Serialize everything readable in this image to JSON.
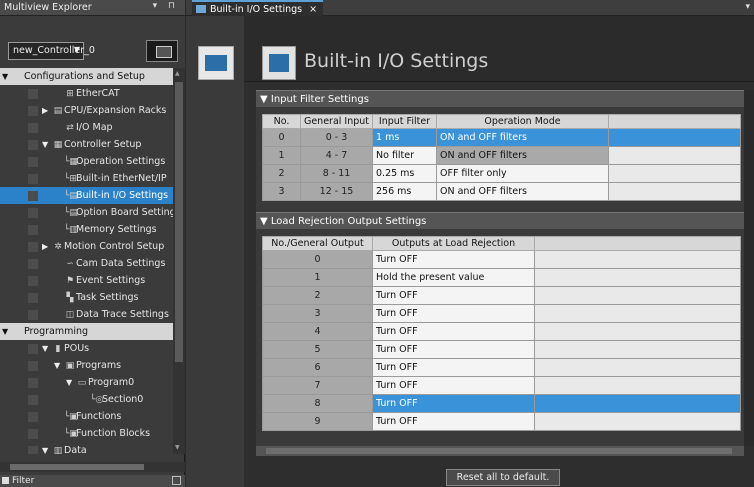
{
  "explorer": {
    "title": "Multiview Explorer",
    "title_controls": "▾ ⊓",
    "controller": "new_Controller_0",
    "tree": [
      {
        "label": "Configurations and Setup",
        "level": 0,
        "type": "header",
        "exp": "▼",
        "icon": ""
      },
      {
        "label": "EtherCAT",
        "level": 2,
        "exp": "",
        "icon": "⊞"
      },
      {
        "label": "CPU/Expansion Racks",
        "level": 1,
        "exp": "▶",
        "icon": "▤"
      },
      {
        "label": "I/O Map",
        "level": 2,
        "exp": "",
        "icon": "⇄"
      },
      {
        "label": "Controller Setup",
        "level": 1,
        "exp": "▼",
        "icon": "▦"
      },
      {
        "label": "Operation Settings",
        "level": 2,
        "exp": "",
        "icon": "└▦"
      },
      {
        "label": "Built-in EtherNet/IP",
        "level": 2,
        "exp": "",
        "icon": "└⊞"
      },
      {
        "label": "Built-in I/O Settings",
        "level": 2,
        "exp": "",
        "icon": "└▤",
        "selected": true
      },
      {
        "label": "Option Board Settings",
        "level": 2,
        "exp": "",
        "icon": "└▤"
      },
      {
        "label": "Memory Settings",
        "level": 2,
        "exp": "",
        "icon": "└▥"
      },
      {
        "label": "Motion Control Setup",
        "level": 1,
        "exp": "▶",
        "icon": "✲"
      },
      {
        "label": "Cam Data Settings",
        "level": 2,
        "exp": "",
        "icon": "∽"
      },
      {
        "label": "Event Settings",
        "level": 2,
        "exp": "",
        "icon": "⚑"
      },
      {
        "label": "Task Settings",
        "level": 2,
        "exp": "",
        "icon": "▚"
      },
      {
        "label": "Data Trace Settings",
        "level": 2,
        "exp": "",
        "icon": "◫"
      },
      {
        "label": "Programming",
        "level": 0,
        "type": "header",
        "exp": "▼",
        "icon": ""
      },
      {
        "label": "POUs",
        "level": 1,
        "exp": "▼",
        "icon": "▮"
      },
      {
        "label": "Programs",
        "level": 2,
        "exp": "▼",
        "icon": "▣"
      },
      {
        "label": "Program0",
        "level": 3,
        "exp": "▼",
        "icon": "▭"
      },
      {
        "label": "Section0",
        "level": 4,
        "exp": "",
        "icon": "└◎"
      },
      {
        "label": "Functions",
        "level": 2,
        "exp": "",
        "icon": "└▣"
      },
      {
        "label": "Function Blocks",
        "level": 2,
        "exp": "",
        "icon": "└▣"
      },
      {
        "label": "Data",
        "level": 1,
        "exp": "▼",
        "icon": "▥"
      }
    ],
    "filter_label": "Filter"
  },
  "tab": {
    "label": "Built-in I/O Settings",
    "close": "×",
    "menu": "▾"
  },
  "page_title": "Built-in I/O Settings",
  "input_filter": {
    "section_label": "▼ Input Filter Settings",
    "headers": [
      "No.",
      "General Input",
      "Input Filter",
      "Operation Mode",
      ""
    ],
    "rows": [
      {
        "no": "0",
        "input": "0 - 3",
        "filter": "1 ms",
        "mode": "ON and OFF filters",
        "filter_sel": true,
        "mode_sel": true
      },
      {
        "no": "1",
        "input": "4 - 7",
        "filter": "No filter",
        "mode": "ON and OFF filters",
        "filter_sel": false,
        "mode_grey": true
      },
      {
        "no": "2",
        "input": "8 - 11",
        "filter": "0.25 ms",
        "mode": "OFF filter only"
      },
      {
        "no": "3",
        "input": "12 - 15",
        "filter": "256 ms",
        "mode": "ON and OFF filters"
      }
    ]
  },
  "load_rejection": {
    "section_label": "▼ Load Rejection Output Settings",
    "headers": [
      "No./General Output",
      "Outputs at Load Rejection",
      ""
    ],
    "rows": [
      {
        "no": "0",
        "value": "Turn OFF"
      },
      {
        "no": "1",
        "value": "Hold the present value"
      },
      {
        "no": "2",
        "value": "Turn OFF"
      },
      {
        "no": "3",
        "value": "Turn OFF"
      },
      {
        "no": "4",
        "value": "Turn OFF"
      },
      {
        "no": "5",
        "value": "Turn OFF"
      },
      {
        "no": "6",
        "value": "Turn OFF"
      },
      {
        "no": "7",
        "value": "Turn OFF"
      },
      {
        "no": "8",
        "value": "Turn OFF",
        "selected": true
      },
      {
        "no": "9",
        "value": "Turn OFF"
      }
    ]
  },
  "reset_label": "Reset all to default."
}
